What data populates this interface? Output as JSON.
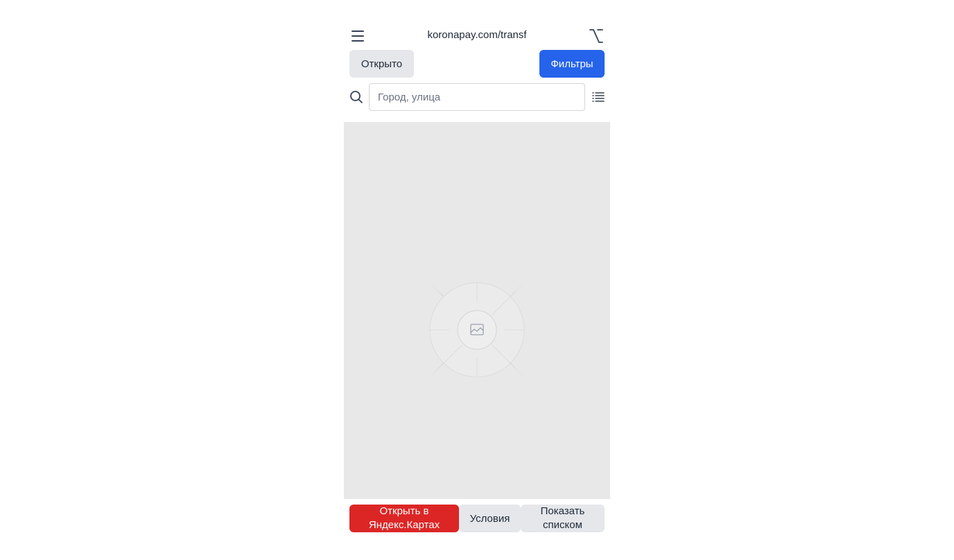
{
  "header": {
    "menu_icon": "hamburger-menu-icon",
    "url": "koronapay.com/transf",
    "options_icon": "option-key-icon"
  },
  "filters": {
    "open_label": "Открыто",
    "filters_label": "Фильтры",
    "filters_color": "#2563eb"
  },
  "search": {
    "icon": "search-icon",
    "placeholder": "Город, улица",
    "value": "",
    "list_icon": "list-icon"
  },
  "map": {
    "placeholder_icon": "image-placeholder-icon"
  },
  "bottom": {
    "yandex_label": "Открыть в Яндекс.Картах",
    "yandex_color": "#dc2626",
    "terms_label": "Условия",
    "show_list_label": "Показать списком"
  }
}
